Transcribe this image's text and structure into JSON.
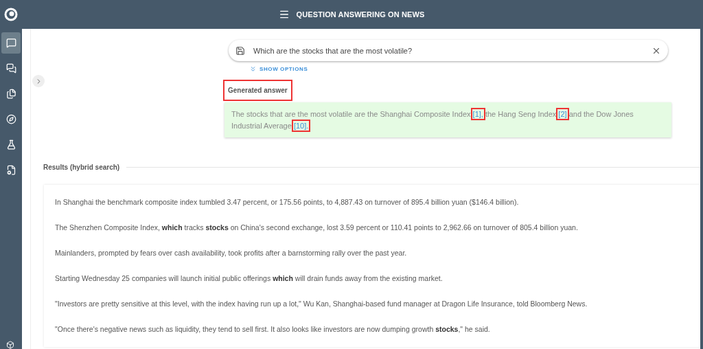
{
  "header": {
    "title": "QUESTION ANSWERING ON NEWS"
  },
  "sidebar": {
    "items": [
      {
        "kind": "ask",
        "selected": true
      },
      {
        "kind": "chat",
        "selected": false
      },
      {
        "kind": "docs",
        "selected": false
      },
      {
        "kind": "explore",
        "selected": false
      },
      {
        "kind": "lab",
        "selected": false
      },
      {
        "kind": "settings",
        "selected": false
      }
    ]
  },
  "search": {
    "value": "Which are the stocks that are the most volatile?",
    "options_label": "SHOW OPTIONS"
  },
  "answer": {
    "heading": "Generated answer",
    "heading_highlighted": true,
    "parts": [
      {
        "kind": "text",
        "text": "The stocks that are the most volatile are the Shanghai Composite Index "
      },
      {
        "kind": "cite",
        "text": "[1],",
        "highlighted": true
      },
      {
        "kind": "text",
        "text": " the Hang Seng Index "
      },
      {
        "kind": "cite",
        "text": "[2]",
        "highlighted": true
      },
      {
        "kind": "text",
        "text": " and the Dow Jones Industrial Average "
      },
      {
        "kind": "cite",
        "text": "[10].",
        "highlighted": true
      }
    ]
  },
  "results": {
    "title": "Results (hybrid search)",
    "paragraphs": [
      "In Shanghai the benchmark composite index tumbled 3.47 percent, or 175.56 points, to 4,887.43 on turnover of 895.4 billion yuan ($146.4 billion).",
      "The Shenzhen Composite Index, **which** tracks **stocks** on China's second exchange, lost 3.59 percent or 110.41 points to 2,962.66 on turnover of 805.4 billion yuan.",
      "Mainlanders, prompted by fears over cash availability, took profits after a barnstorming rally over the past year.",
      "Starting Wednesday 25 companies will launch initial public offerings  **which** will drain funds away from the existing market.",
      "\"Investors are pretty sensitive at this level, with the index having run up a lot,\" Wu Kan, Shanghai-based fund manager at Dragon Life Insurance, told Bloomberg News.",
      "\"Once there's negative news such as liquidity, they tend to sell first. It also looks like investors are now dumping growth **stocks**,\" he said."
    ]
  }
}
